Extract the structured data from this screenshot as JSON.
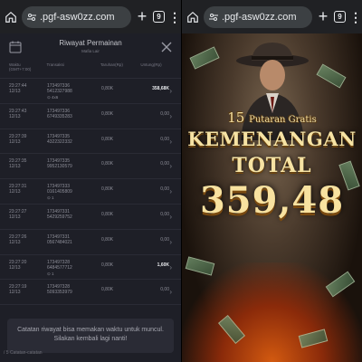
{
  "left_browser": {
    "url": ".pgf-asw0zz.com",
    "tab_count": "9"
  },
  "right_browser": {
    "url": ".pgf-asw0zz.com",
    "tab_count": "9"
  },
  "history": {
    "title": "Riwayat Permainan",
    "subtitle": "Mafia Lair",
    "columns": {
      "time": "Waktu",
      "time_sub": "(GMT+7:00)",
      "transaction": "Transaksi",
      "bet": "Taruhan(Rp)",
      "win": "Untung(Rp)"
    },
    "rows": [
      {
        "time": "23:27:44",
        "date": "12/13",
        "tx1": "173497336",
        "tx2": "5412327988",
        "badge": "⊙ 4x6",
        "bet": "0,80K",
        "win": "358,68K",
        "highlight": true
      },
      {
        "time": "23:27:43",
        "date": "12/13",
        "tx1": "173497336",
        "tx2": "6749335283",
        "badge": "",
        "bet": "0,80K",
        "win": "0,00",
        "highlight": false
      },
      {
        "time": "23:27:39",
        "date": "12/13",
        "tx1": "173497335",
        "tx2": "4322322332",
        "badge": "",
        "bet": "0,80K",
        "win": "0,00",
        "highlight": false
      },
      {
        "time": "23:27:35",
        "date": "12/13",
        "tx1": "173497335",
        "tx2": "9952130579",
        "badge": "",
        "bet": "0,80K",
        "win": "0,00",
        "highlight": false
      },
      {
        "time": "23:27:31",
        "date": "12/13",
        "tx1": "173497333",
        "tx2": "0161405809",
        "badge": "⊙ 1",
        "bet": "0,80K",
        "win": "0,00",
        "highlight": false
      },
      {
        "time": "23:27:27",
        "date": "12/13",
        "tx1": "173497331",
        "tx2": "5429259752",
        "badge": "",
        "bet": "0,80K",
        "win": "0,00",
        "highlight": false
      },
      {
        "time": "23:27:26",
        "date": "12/13",
        "tx1": "173497331",
        "tx2": "0567484021",
        "badge": "",
        "bet": "0,80K",
        "win": "0,00",
        "highlight": false
      },
      {
        "time": "23:27:20",
        "date": "12/13",
        "tx1": "173497328",
        "tx2": "6484577712",
        "badge": "⊙ 1",
        "bet": "0,80K",
        "win": "1,60K",
        "highlight": false
      },
      {
        "time": "23:27:19",
        "date": "12/13",
        "tx1": "173497328",
        "tx2": "5093353979",
        "badge": "",
        "bet": "0,80K",
        "win": "0,00",
        "highlight": false
      }
    ],
    "notice": "Catatan riwayat bisa memakan waktu untuk muncul. Silakan kembali lagi nanti!",
    "footer": "/ 5 Catatan-catatan"
  },
  "promo": {
    "spins_number": "15",
    "spins_label": "Putaran Gratis",
    "headline": "KEMENANGAN",
    "headline2": "TOTAL",
    "amount": "359,48"
  }
}
